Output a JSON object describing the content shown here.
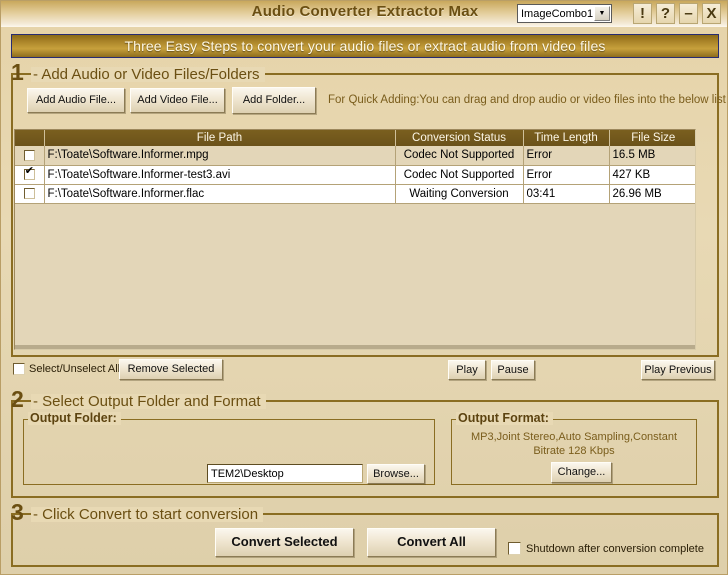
{
  "window": {
    "title": "Audio Converter Extractor Max",
    "combo": {
      "value": "ImageCombo1",
      "arrow_icon": "chevron-down-icon"
    },
    "buttons": {
      "alert": "!",
      "help": "?",
      "minimize": "–",
      "close": "X"
    }
  },
  "banner": {
    "text": "Three Easy Steps to convert your audio files or extract audio from video files"
  },
  "step1": {
    "number": "1",
    "title": "- Add Audio or Video Files/Folders",
    "add_audio_label": "Add Audio File...",
    "add_video_label": "Add Video File...",
    "add_folder_label": "Add Folder...",
    "hint": "For Quick Adding:You can drag and drop audio or video files into the below list",
    "table": {
      "columns": [
        "",
        "File Path",
        "Conversion Status",
        "Time Length",
        "File Size"
      ],
      "rows": [
        {
          "checked": false,
          "path": "F:\\Toate\\Software.Informer.mpg",
          "status": "Codec Not Supported",
          "time": "Error",
          "size": "16.5 MB",
          "error": false
        },
        {
          "checked": true,
          "path": "F:\\Toate\\Software.Informer-test3.avi",
          "status": "Codec Not Supported",
          "time": "Error",
          "size": "427 KB",
          "error": true
        },
        {
          "checked": false,
          "path": "F:\\Toate\\Software.Informer.flac",
          "status": "Waiting Conversion",
          "time": "03:41",
          "size": "26.96 MB",
          "error": false
        }
      ]
    },
    "select_all_label": "Select/Unselect All",
    "select_all_checked": false,
    "remove_selected_label": "Remove Selected",
    "play_label": "Play",
    "pause_label": "Pause",
    "play_previous_label": "Play Previous"
  },
  "step2": {
    "number": "2",
    "title": "- Select Output Folder and Format",
    "output_folder_title": "Output Folder:",
    "folder_value": "TEM2\\Desktop",
    "browse_label": "Browse...",
    "output_format_title": "Output Format:",
    "format_desc": "MP3,Joint Stereo,Auto Sampling,Constant Bitrate 128 Kbps",
    "change_label": "Change..."
  },
  "step3": {
    "number": "3",
    "title": "- Click Convert to start conversion",
    "convert_selected_label": "Convert Selected",
    "convert_all_label": "Convert All",
    "shutdown_label": "Shutdown after conversion complete",
    "shutdown_checked": false
  },
  "colors": {
    "background": "#e8d9b4",
    "banner_gold": "#a98328",
    "banner_border": "#272c73",
    "group_border": "#8a6d22",
    "header_brown": "#6b521a",
    "error_red": "#e00000",
    "title_text": "#6b4f12"
  }
}
